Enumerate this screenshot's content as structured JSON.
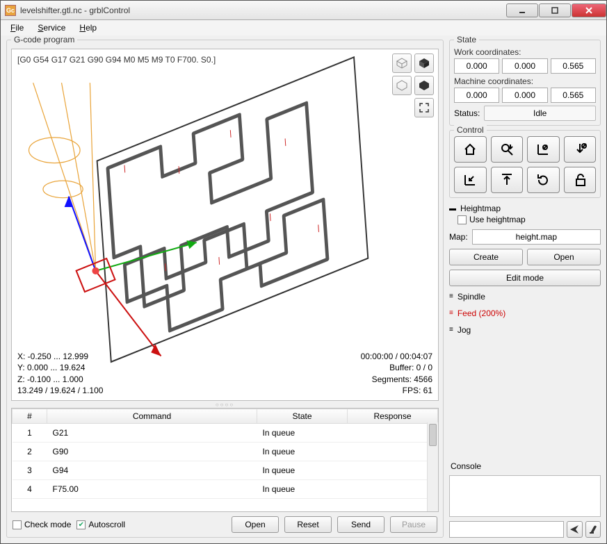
{
  "window": {
    "title": "levelshifter.gtl.nc - grblControl"
  },
  "menu": {
    "file": "File",
    "service": "Service",
    "help": "Help"
  },
  "gcode": {
    "legend": "G-code program",
    "current_line": "[G0 G54 G17 G21 G90 G94 M0 M5 M9 T0 F700. S0.]",
    "stats_left": {
      "x": "X: -0.250 ... 12.999",
      "y": "Y: 0.000 ... 19.624",
      "z": "Z: -0.100 ... 1.000",
      "sz": "13.249 / 19.624 / 1.100"
    },
    "stats_right": {
      "time": "00:00:00 / 00:04:07",
      "buffer": "Buffer: 0 / 0",
      "segments": "Segments: 4566",
      "fps": "FPS: 61"
    }
  },
  "table": {
    "headers": {
      "num": "#",
      "cmd": "Command",
      "state": "State",
      "resp": "Response"
    },
    "rows": [
      {
        "n": "1",
        "cmd": "G21",
        "state": "In queue",
        "resp": ""
      },
      {
        "n": "2",
        "cmd": "G90",
        "state": "In queue",
        "resp": ""
      },
      {
        "n": "3",
        "cmd": "G94",
        "state": "In queue",
        "resp": ""
      },
      {
        "n": "4",
        "cmd": "F75.00",
        "state": "In queue",
        "resp": ""
      }
    ]
  },
  "bottom": {
    "check_mode": "Check mode",
    "autoscroll": "Autoscroll",
    "open": "Open",
    "reset": "Reset",
    "send": "Send",
    "pause": "Pause"
  },
  "state": {
    "legend": "State",
    "work_label": "Work coordinates:",
    "work": {
      "x": "0.000",
      "y": "0.000",
      "z": "0.565"
    },
    "mach_label": "Machine coordinates:",
    "mach": {
      "x": "0.000",
      "y": "0.000",
      "z": "0.565"
    },
    "status_label": "Status:",
    "status_value": "Idle"
  },
  "control": {
    "legend": "Control"
  },
  "heightmap": {
    "head": "Heightmap",
    "use": "Use heightmap",
    "map_label": "Map:",
    "map_value": "height.map",
    "create": "Create",
    "open": "Open",
    "edit": "Edit mode"
  },
  "spindle": {
    "head": "Spindle"
  },
  "feed": {
    "head": "Feed (200%)"
  },
  "jog": {
    "head": "Jog"
  },
  "console": {
    "head": "Console"
  }
}
